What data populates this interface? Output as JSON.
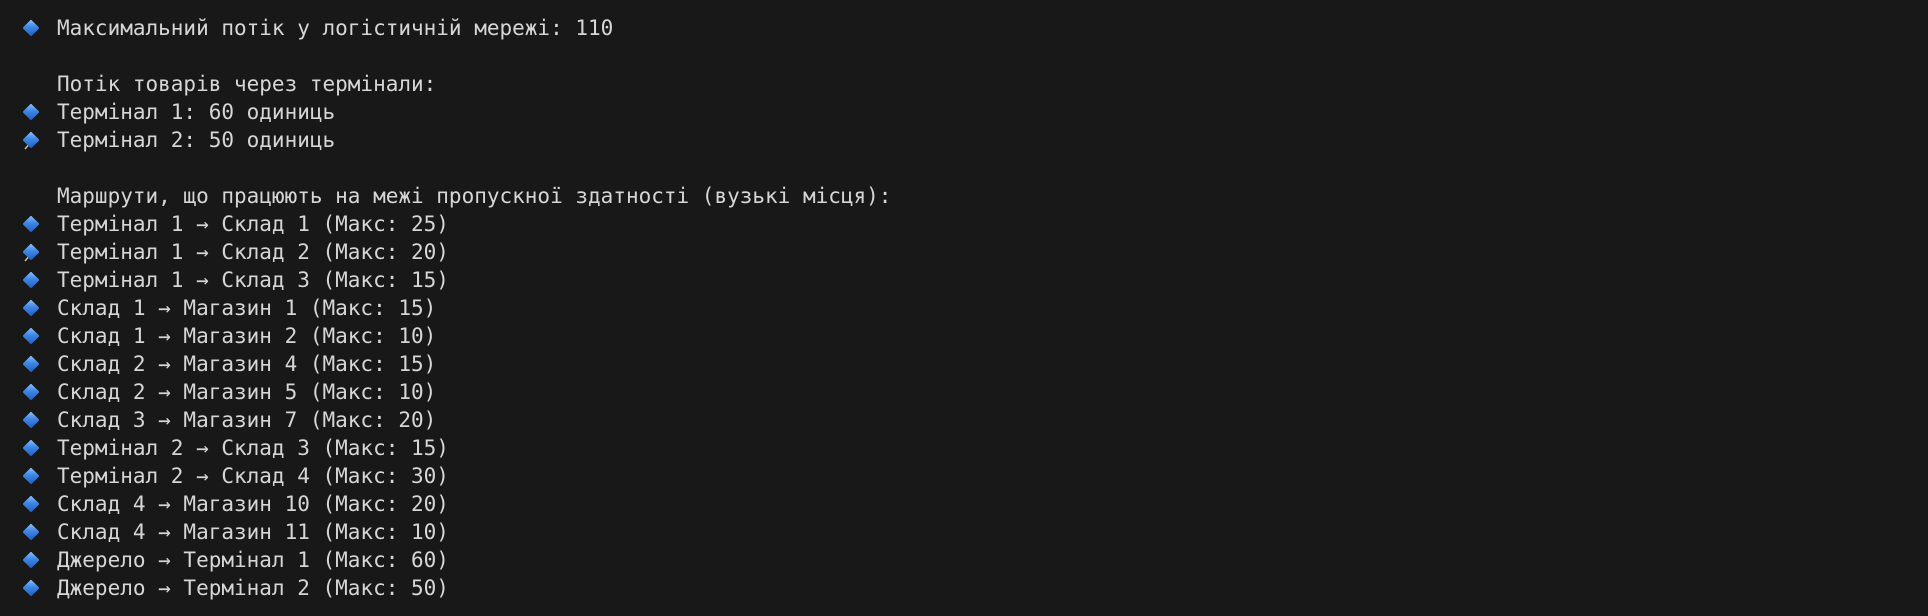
{
  "summary": {
    "max_flow": "Максимальний потік у логістичній мережі: 110"
  },
  "terminals": {
    "heading": "Потік товарів через термінали:",
    "items": [
      "Термінал 1: 60 одиниць",
      "Термінал 2: 50 одиниць"
    ]
  },
  "bottlenecks": {
    "heading": "Маршрути, що працюють на межі пропускної здатності (вузькі місця):",
    "items": [
      "Термінал 1 → Склад 1 (Макс: 25)",
      "Термінал 1 → Склад 2 (Макс: 20)",
      "Термінал 1 → Склад 3 (Макс: 15)",
      "Склад 1 → Магазин 1 (Макс: 15)",
      "Склад 1 → Магазин 2 (Макс: 10)",
      "Склад 2 → Магазин 4 (Макс: 15)",
      "Склад 2 → Магазин 5 (Макс: 10)",
      "Склад 3 → Магазин 7 (Макс: 20)",
      "Термінал 2 → Склад 3 (Макс: 15)",
      "Термінал 2 → Склад 4 (Макс: 30)",
      "Склад 4 → Магазин 10 (Макс: 20)",
      "Склад 4 → Магазин 11 (Макс: 10)",
      "Джерело → Термінал 1 (Макс: 60)",
      "Джерело → Термінал 2 (Макс: 50)"
    ]
  },
  "icons": {
    "bullet": "blue-diamond-icon",
    "heading": "pushpin-icon"
  },
  "colors": {
    "background": "#181818",
    "text": "#d6d6d6",
    "diamond": "#3e86e6",
    "pin": "#d8413a"
  }
}
